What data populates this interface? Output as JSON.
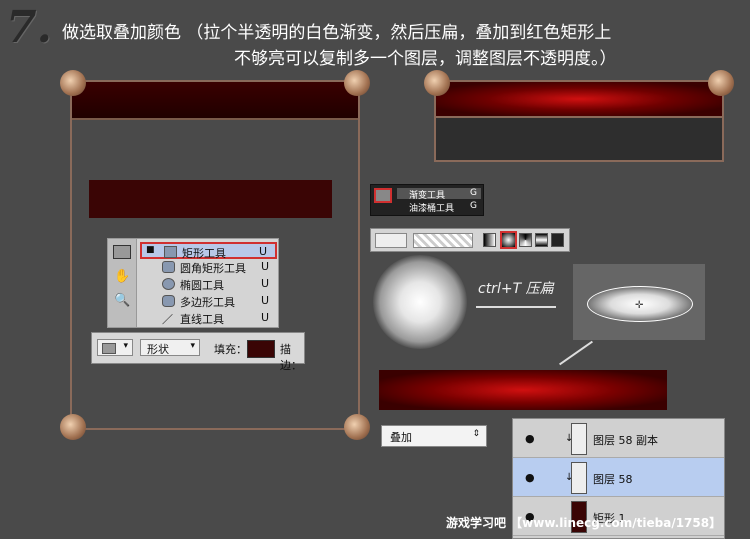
{
  "step": "7.",
  "title_line1": "做选取叠加颜色 （拉个半透明的白色渐变，然后压扁，叠加到红色矩形上",
  "title_line2": "不够亮可以复制多一个图层，调整图层不透明度。）",
  "tools_flyout": {
    "items": [
      {
        "label": "矩形工具",
        "key": "U",
        "selected": true
      },
      {
        "label": "圆角矩形工具",
        "key": "U"
      },
      {
        "label": "椭圆工具",
        "key": "U"
      },
      {
        "label": "多边形工具",
        "key": "U"
      },
      {
        "label": "直线工具",
        "key": "U"
      }
    ]
  },
  "options_bar": {
    "mode": "形状",
    "fill_label": "填充：",
    "stroke_label": "描边：",
    "fill_color": "#3a0505"
  },
  "gradient_flyout": {
    "items": [
      {
        "label": "渐变工具",
        "key": "G"
      },
      {
        "label": "油漆桶工具",
        "key": "G"
      }
    ]
  },
  "annotation": "ctrl+T 压扁",
  "blend_mode": "叠加",
  "layers": [
    {
      "name": "图层 58 副本",
      "selected": false
    },
    {
      "name": "图层 58",
      "selected": true
    },
    {
      "name": "矩形 1",
      "selected": false
    }
  ],
  "watermark": "游戏学习吧 【www.linecg.com/tieba/1758】",
  "colors": {
    "dark_red": "#3a0505",
    "bright_red": "#d01010",
    "selection_blue": "#b8cdf0"
  }
}
